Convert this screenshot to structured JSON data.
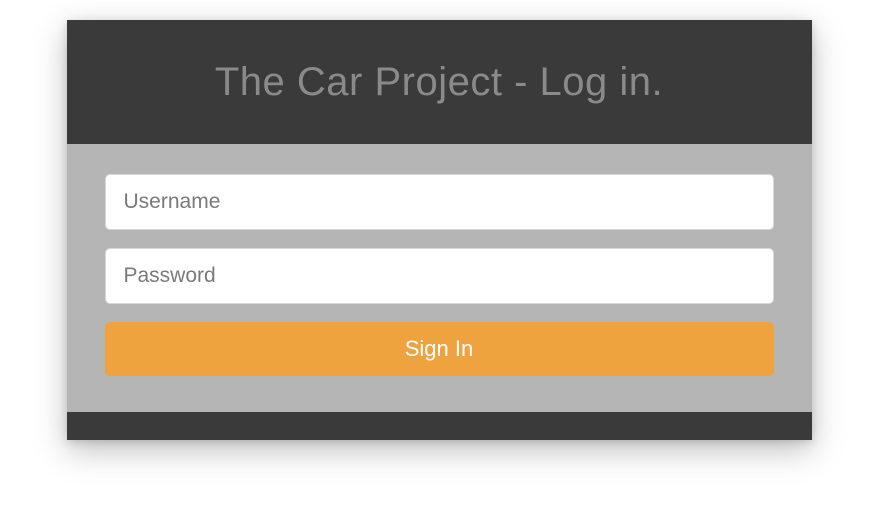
{
  "header": {
    "title": "The Car Project - Log in."
  },
  "form": {
    "username": {
      "value": "",
      "placeholder": "Username"
    },
    "password": {
      "value": "",
      "placeholder": "Password"
    },
    "submit_label": "Sign In"
  },
  "colors": {
    "header_bg": "#3a3a3a",
    "body_bg": "#b5b5b5",
    "accent": "#efa33f"
  }
}
